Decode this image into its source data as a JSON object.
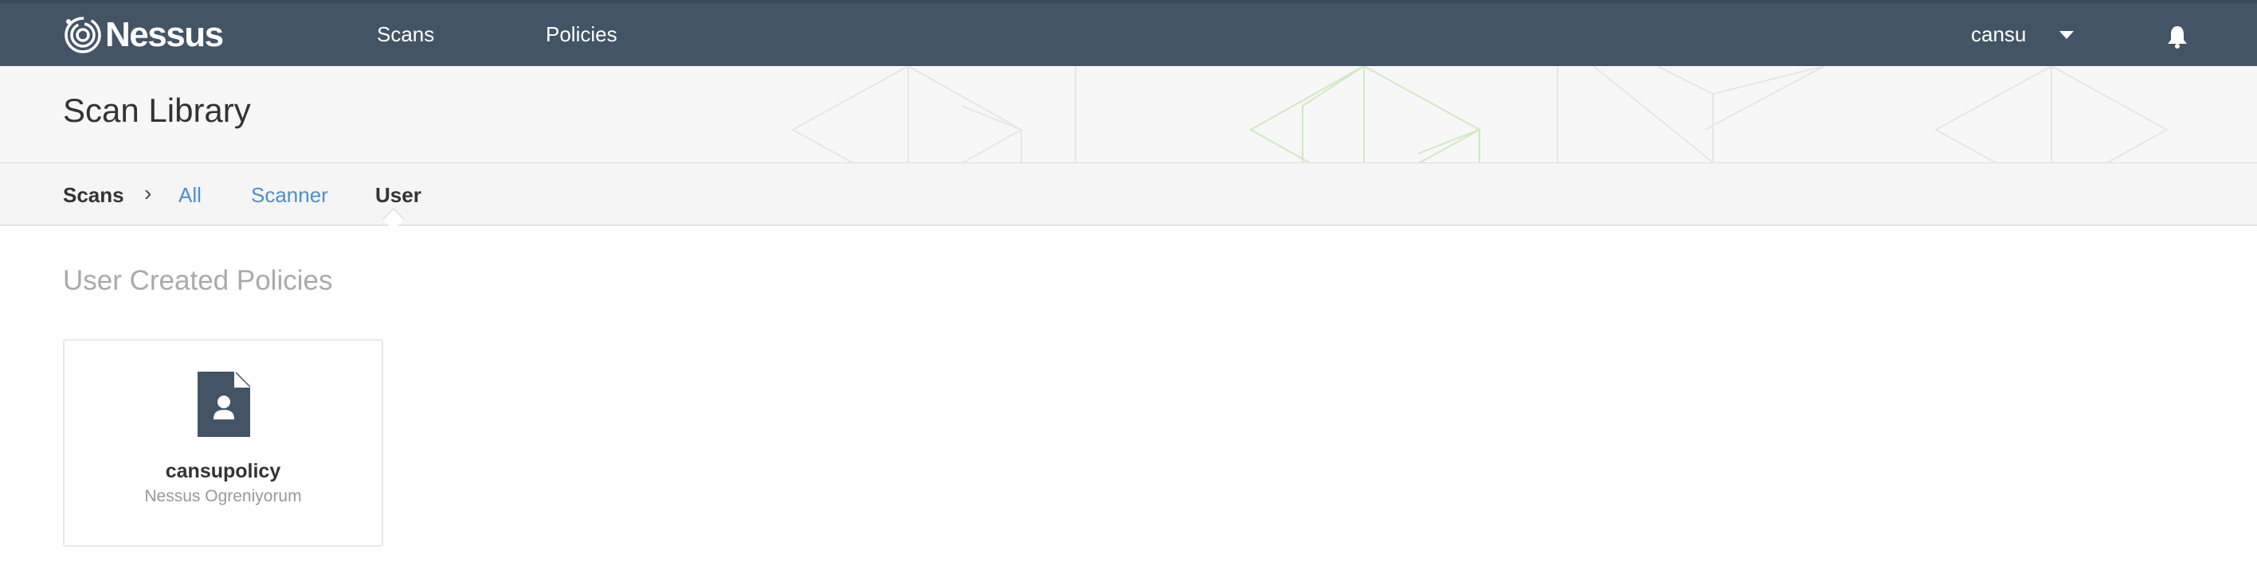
{
  "colors": {
    "topbar": "#435466",
    "link": "#4c8fce",
    "accent_green": "#8fd66a"
  },
  "header": {
    "logo_text": "Nessus",
    "nav": [
      "Scans",
      "Policies"
    ],
    "user": "cansu",
    "icons": [
      "nessus-logo-icon",
      "caret-down-icon",
      "bell-icon"
    ]
  },
  "page": {
    "title": "Scan Library"
  },
  "breadcrumb": {
    "root": "Scans",
    "items": [
      "All",
      "Scanner",
      "User"
    ],
    "active": "User"
  },
  "section": {
    "title": "User Created Policies"
  },
  "policies": [
    {
      "name": "cansupolicy",
      "description": "Nessus Ogreniyorum",
      "icon": "user-document-icon"
    }
  ]
}
